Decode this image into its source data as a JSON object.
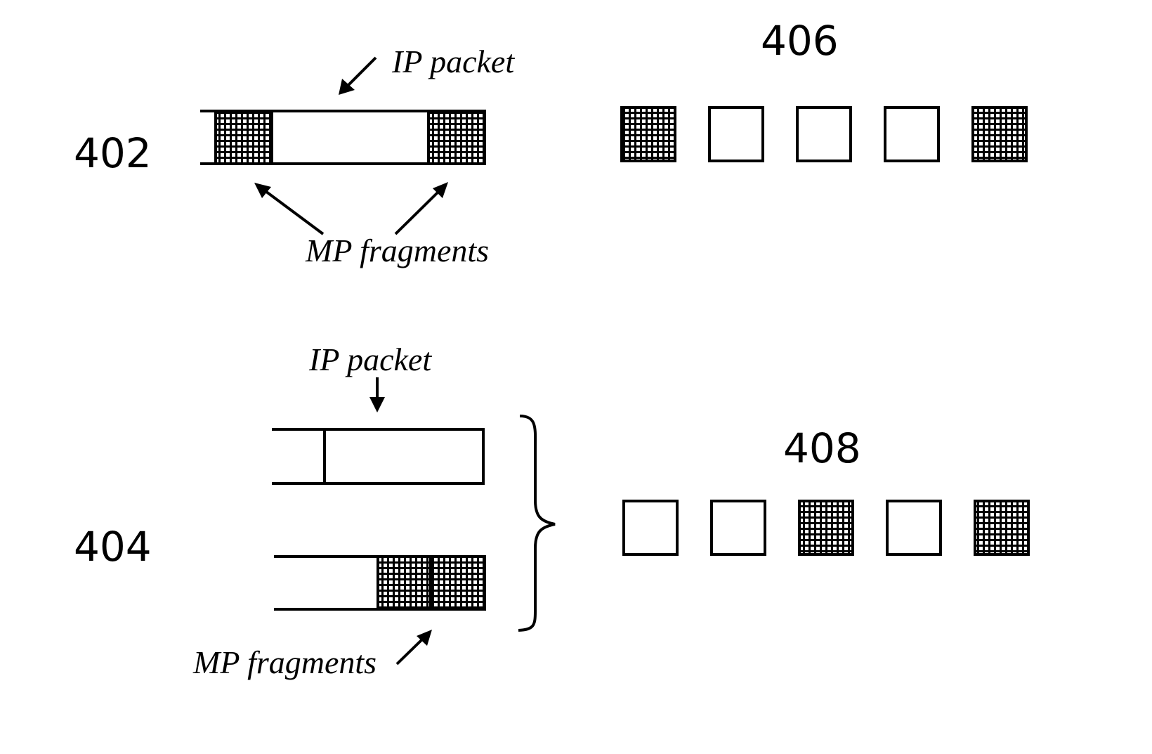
{
  "figure": {
    "labels": {
      "ref_402": "402",
      "ref_404": "404",
      "ref_406": "406",
      "ref_408": "408",
      "ip_packet_top": "IP packet",
      "mp_fragments_top": "MP fragments",
      "ip_packet_bottom": "IP packet",
      "mp_fragments_bottom": "MP fragments"
    },
    "sequence_406": [
      "fragment",
      "empty",
      "empty",
      "empty",
      "fragment"
    ],
    "sequence_408": [
      "empty",
      "empty",
      "fragment",
      "empty",
      "fragment"
    ],
    "colors": {
      "ink": "#000000",
      "paper": "#ffffff"
    }
  }
}
